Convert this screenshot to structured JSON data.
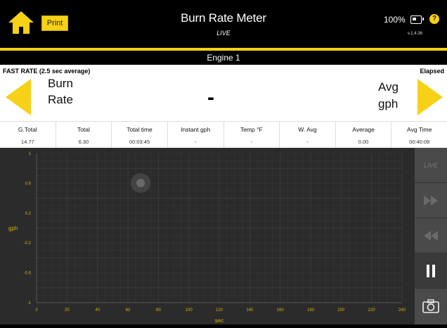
{
  "header": {
    "title": "Burn Rate Meter",
    "subtitle": "LIVE",
    "print_label": "Print",
    "battery_percent": "100%",
    "help_label": "?",
    "version": "v.1.4.36"
  },
  "engine_label": "Engine 1",
  "burn_panel": {
    "mode_label": "FAST RATE (2.5 sec average)",
    "elapsed_label": "Elapsed",
    "left_line1": "Burn",
    "left_line2": "Rate",
    "value": "-",
    "right_line1": "Avg",
    "right_line2": "gph"
  },
  "stats": [
    {
      "label": "G.Total",
      "value": "14.77"
    },
    {
      "label": "Total",
      "value": "6.30"
    },
    {
      "label": "Total time",
      "value": "00:03:45"
    },
    {
      "label": "Instant gph",
      "value": "-"
    },
    {
      "label": "Temp °F",
      "value": "-"
    },
    {
      "label": "W. Avg",
      "value": "-"
    },
    {
      "label": "Average",
      "value": "0.00"
    },
    {
      "label": "Avg Time",
      "value": "00:40:08"
    }
  ],
  "side_buttons": {
    "live_label": "LIVE"
  },
  "colors": {
    "accent": "#f7d117",
    "chart_bg": "#2b2b2b",
    "grid": "#3c3c3c",
    "axis_text": "#d8b000"
  },
  "chart_data": {
    "type": "line",
    "xlabel": "sec",
    "ylabel": "gph",
    "xlim": [
      0,
      240
    ],
    "ylim": [
      -1,
      1
    ],
    "x_ticks": [
      0,
      20,
      40,
      60,
      80,
      100,
      120,
      140,
      160,
      180,
      200,
      220,
      240
    ],
    "y_ticks": [
      1,
      0.6,
      0.2,
      -0.2,
      -0.6,
      -1
    ],
    "y_tick_labels": [
      "1",
      "0.6",
      "0.2",
      "-0.2",
      "-0.6",
      "-1"
    ],
    "grid": true,
    "series": []
  }
}
